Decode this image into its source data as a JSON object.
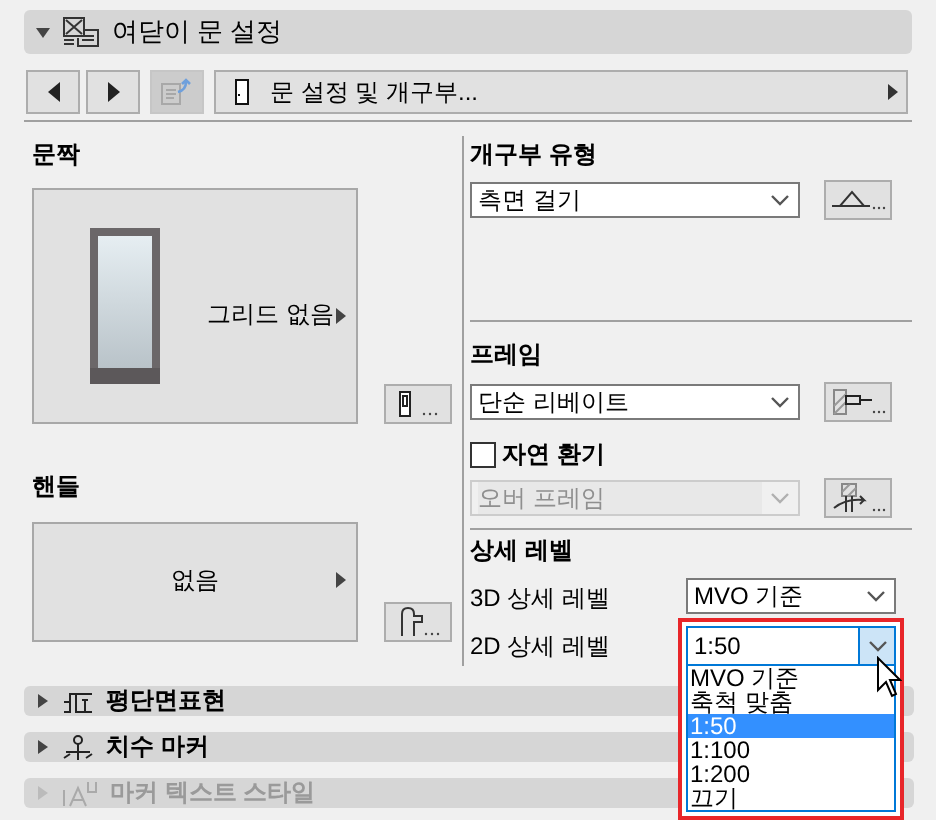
{
  "panel": {
    "title": "여닫이 문 설정",
    "expanded": true
  },
  "nav": {
    "buttons": [
      {
        "kind": "previous",
        "disabled": false
      },
      {
        "kind": "next",
        "disabled": false
      },
      {
        "kind": "transfer",
        "disabled": true
      }
    ],
    "value": "문 설정 및 개구부..."
  },
  "leaf": {
    "label": "문짝",
    "grid": "그리드 없음"
  },
  "handle": {
    "label": "핸들",
    "value": "없음"
  },
  "opening_type": {
    "label": "개구부 유형",
    "value": "측면 걸기"
  },
  "frame": {
    "label": "프레임",
    "value": "단순 리베이트"
  },
  "ventilation": {
    "label": "자연 환기",
    "checked": false,
    "select": {
      "value": "오버 프레임",
      "disabled": true
    }
  },
  "detail_level": {
    "label": "상세 레벨",
    "rows": [
      {
        "label": "3D 상세 레벨",
        "value": "MVO 기준",
        "open": false
      },
      {
        "label": "2D 상세 레벨",
        "value": "1:50",
        "open": true,
        "options": [
          {
            "label": "MVO 기준",
            "selected": false
          },
          {
            "label": "축척 맞춤",
            "selected": false
          },
          {
            "label": "1:50",
            "selected": true
          },
          {
            "label": "1:100",
            "selected": false
          },
          {
            "label": "1:200",
            "selected": false
          },
          {
            "label": "끄기",
            "selected": false
          }
        ]
      }
    ]
  },
  "sections": [
    {
      "kind": "plan",
      "label": "평단면표현",
      "expanded": false,
      "disabled": false
    },
    {
      "kind": "marker",
      "label": "치수 마커",
      "expanded": false,
      "disabled": false
    },
    {
      "kind": "text",
      "label": "마커 텍스트 스타일",
      "expanded": false,
      "disabled": true
    }
  ]
}
